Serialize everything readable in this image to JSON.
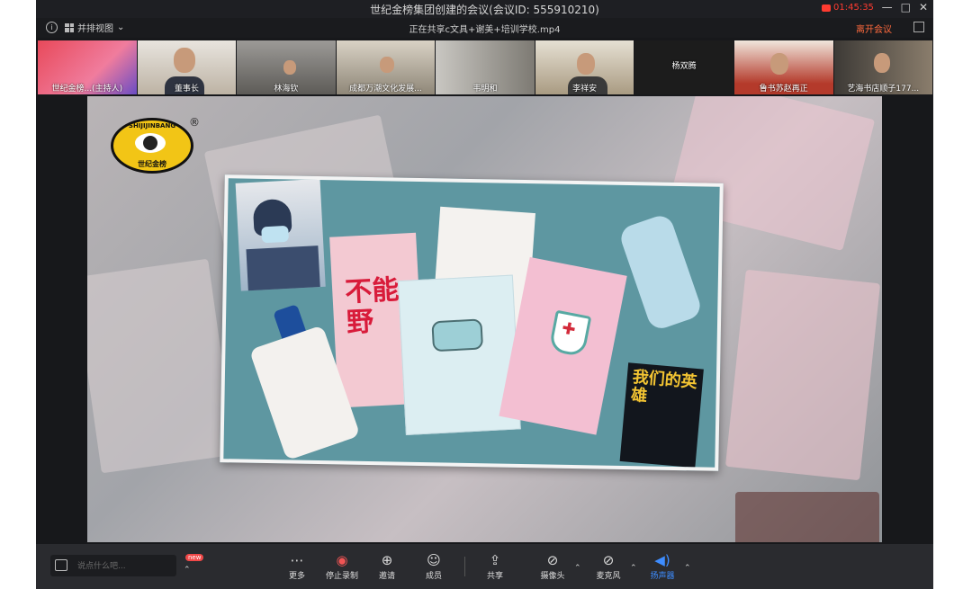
{
  "window": {
    "title": "世纪金榜集团创建的会议(会议ID: 555910210)",
    "recording_time": "01:45:35",
    "controls": [
      "—",
      "□",
      "✕"
    ]
  },
  "subbar": {
    "layout_label": "并排视图",
    "sharing_text": "正在共享c文具+谢美+培训学校.mp4",
    "leave_label": "离开会议"
  },
  "participants": [
    {
      "label": "世纪金榜...(主持人)"
    },
    {
      "label": "董事长"
    },
    {
      "label": "林海钦"
    },
    {
      "label": "成都万潮文化发展..."
    },
    {
      "label": "韦明和"
    },
    {
      "label": "李祥安"
    },
    {
      "label": "杨双腾"
    },
    {
      "label": "鲁书苏赵再正"
    },
    {
      "label": "艺海书店顺子177..."
    }
  ],
  "content": {
    "logo_text": "SHIJIJINBANG",
    "logo_cn": "世纪金榜",
    "registered_mark": "®",
    "book_red_text": "不能野",
    "hero_text": "我们的英雄"
  },
  "toolbar": {
    "chat_placeholder": "说点什么吧...",
    "new_badge": "new",
    "tools": [
      {
        "label": "更多",
        "icon": "more-icon",
        "glyph": "⋯"
      },
      {
        "label": "停止录制",
        "icon": "stop-record-icon",
        "glyph": "◉"
      },
      {
        "label": "邀请",
        "icon": "invite-icon",
        "glyph": "⊕"
      },
      {
        "label": "成员",
        "icon": "members-icon",
        "glyph": "☺"
      },
      {
        "label": "共享",
        "icon": "share-icon",
        "glyph": "⇪"
      },
      {
        "label": "摄像头",
        "icon": "camera-off-icon",
        "glyph": "⊘"
      },
      {
        "label": "麦克风",
        "icon": "mic-off-icon",
        "glyph": "⊘"
      },
      {
        "label": "扬声器",
        "icon": "speaker-icon",
        "glyph": "◀)"
      }
    ]
  },
  "colors": {
    "accent": "#3e8dff",
    "record": "#ff3b30",
    "leave": "#ff6a3d"
  }
}
